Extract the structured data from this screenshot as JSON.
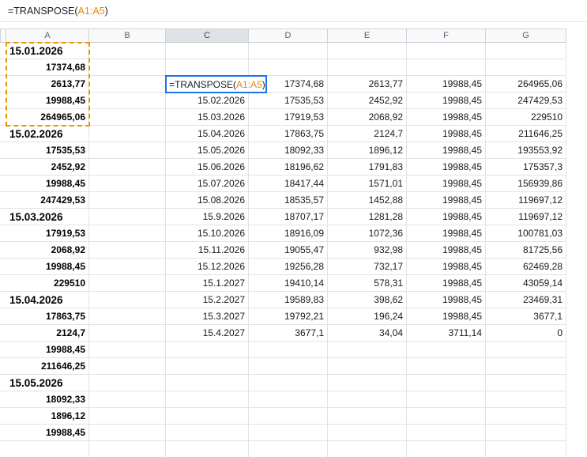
{
  "formula_bar": {
    "prefix": "=TRANSPOSE(",
    "range": "A1:A5",
    "suffix": ")"
  },
  "active_cell": {
    "address": "C3",
    "prefix": "=TRANSPOSE(",
    "range": "A1:A5",
    "suffix": ")"
  },
  "column_headers": [
    "A",
    "B",
    "C",
    "D",
    "E",
    "F",
    "G"
  ],
  "active_column": "C",
  "highlighted_range": "A1:A5",
  "colors": {
    "accent_blue": "#1a73e8",
    "range_orange": "#f09300",
    "formula_orange": "#ea8600",
    "header_bg": "#f8f9fa",
    "gridline": "#e2e3e3"
  },
  "cells": {
    "A": [
      {
        "r": 1,
        "t": "15.01.2026",
        "s": "da"
      },
      {
        "r": 2,
        "t": "17374,68",
        "s": "na"
      },
      {
        "r": 3,
        "t": "2613,77",
        "s": "na"
      },
      {
        "r": 4,
        "t": "19988,45",
        "s": "na"
      },
      {
        "r": 5,
        "t": "264965,06",
        "s": "na"
      },
      {
        "r": 6,
        "t": "15.02.2026",
        "s": "da"
      },
      {
        "r": 7,
        "t": "17535,53",
        "s": "na"
      },
      {
        "r": 8,
        "t": "2452,92",
        "s": "na"
      },
      {
        "r": 9,
        "t": "19988,45",
        "s": "na"
      },
      {
        "r": 10,
        "t": "247429,53",
        "s": "na"
      },
      {
        "r": 11,
        "t": "15.03.2026",
        "s": "da"
      },
      {
        "r": 12,
        "t": "17919,53",
        "s": "na"
      },
      {
        "r": 13,
        "t": "2068,92",
        "s": "na"
      },
      {
        "r": 14,
        "t": "19988,45",
        "s": "na"
      },
      {
        "r": 15,
        "t": "229510",
        "s": "na"
      },
      {
        "r": 16,
        "t": "15.04.2026",
        "s": "da"
      },
      {
        "r": 17,
        "t": "17863,75",
        "s": "na"
      },
      {
        "r": 18,
        "t": "2124,7",
        "s": "na"
      },
      {
        "r": 19,
        "t": "19988,45",
        "s": "na"
      },
      {
        "r": 20,
        "t": "211646,25",
        "s": "na"
      },
      {
        "r": 21,
        "t": "15.05.2026",
        "s": "da"
      },
      {
        "r": 22,
        "t": "18092,33",
        "s": "na"
      },
      {
        "r": 23,
        "t": "1896,12",
        "s": "na"
      },
      {
        "r": 24,
        "t": "19988,45",
        "s": "na"
      }
    ],
    "B": [],
    "C": [
      {
        "r": 4,
        "t": "15.02.2026",
        "s": "d"
      },
      {
        "r": 5,
        "t": "15.03.2026",
        "s": "d"
      },
      {
        "r": 6,
        "t": "15.04.2026",
        "s": "d"
      },
      {
        "r": 7,
        "t": "15.05.2026",
        "s": "d"
      },
      {
        "r": 8,
        "t": "15.06.2026",
        "s": "d"
      },
      {
        "r": 9,
        "t": "15.07.2026",
        "s": "d"
      },
      {
        "r": 10,
        "t": "15.08.2026",
        "s": "d"
      },
      {
        "r": 11,
        "t": "15.9.2026",
        "s": "d"
      },
      {
        "r": 12,
        "t": "15.10.2026",
        "s": "d"
      },
      {
        "r": 13,
        "t": "15.11.2026",
        "s": "d"
      },
      {
        "r": 14,
        "t": "15.12.2026",
        "s": "d"
      },
      {
        "r": 15,
        "t": "15.1.2027",
        "s": "d"
      },
      {
        "r": 16,
        "t": "15.2.2027",
        "s": "d"
      },
      {
        "r": 17,
        "t": "15.3.2027",
        "s": "d"
      },
      {
        "r": 18,
        "t": "15.4.2027",
        "s": "d"
      }
    ],
    "D": [
      {
        "r": 3,
        "t": "17374,68",
        "s": "n"
      },
      {
        "r": 4,
        "t": "17535,53",
        "s": "n"
      },
      {
        "r": 5,
        "t": "17919,53",
        "s": "n"
      },
      {
        "r": 6,
        "t": "17863,75",
        "s": "n"
      },
      {
        "r": 7,
        "t": "18092,33",
        "s": "n"
      },
      {
        "r": 8,
        "t": "18196,62",
        "s": "n"
      },
      {
        "r": 9,
        "t": "18417,44",
        "s": "n"
      },
      {
        "r": 10,
        "t": "18535,57",
        "s": "n"
      },
      {
        "r": 11,
        "t": "18707,17",
        "s": "n"
      },
      {
        "r": 12,
        "t": "18916,09",
        "s": "n"
      },
      {
        "r": 13,
        "t": "19055,47",
        "s": "n"
      },
      {
        "r": 14,
        "t": "19256,28",
        "s": "n"
      },
      {
        "r": 15,
        "t": "19410,14",
        "s": "n"
      },
      {
        "r": 16,
        "t": "19589,83",
        "s": "n"
      },
      {
        "r": 17,
        "t": "19792,21",
        "s": "n"
      },
      {
        "r": 18,
        "t": "3677,1",
        "s": "n"
      }
    ],
    "E": [
      {
        "r": 3,
        "t": "2613,77",
        "s": "n"
      },
      {
        "r": 4,
        "t": "2452,92",
        "s": "n"
      },
      {
        "r": 5,
        "t": "2068,92",
        "s": "n"
      },
      {
        "r": 6,
        "t": "2124,7",
        "s": "n"
      },
      {
        "r": 7,
        "t": "1896,12",
        "s": "n"
      },
      {
        "r": 8,
        "t": "1791,83",
        "s": "n"
      },
      {
        "r": 9,
        "t": "1571,01",
        "s": "n"
      },
      {
        "r": 10,
        "t": "1452,88",
        "s": "n"
      },
      {
        "r": 11,
        "t": "1281,28",
        "s": "n"
      },
      {
        "r": 12,
        "t": "1072,36",
        "s": "n"
      },
      {
        "r": 13,
        "t": "932,98",
        "s": "n"
      },
      {
        "r": 14,
        "t": "732,17",
        "s": "n"
      },
      {
        "r": 15,
        "t": "578,31",
        "s": "n"
      },
      {
        "r": 16,
        "t": "398,62",
        "s": "n"
      },
      {
        "r": 17,
        "t": "196,24",
        "s": "n"
      },
      {
        "r": 18,
        "t": "34,04",
        "s": "n"
      }
    ],
    "F": [
      {
        "r": 3,
        "t": "19988,45",
        "s": "n"
      },
      {
        "r": 4,
        "t": "19988,45",
        "s": "n"
      },
      {
        "r": 5,
        "t": "19988,45",
        "s": "n"
      },
      {
        "r": 6,
        "t": "19988,45",
        "s": "n"
      },
      {
        "r": 7,
        "t": "19988,45",
        "s": "n"
      },
      {
        "r": 8,
        "t": "19988,45",
        "s": "n"
      },
      {
        "r": 9,
        "t": "19988,45",
        "s": "n"
      },
      {
        "r": 10,
        "t": "19988,45",
        "s": "n"
      },
      {
        "r": 11,
        "t": "19988,45",
        "s": "n"
      },
      {
        "r": 12,
        "t": "19988,45",
        "s": "n"
      },
      {
        "r": 13,
        "t": "19988,45",
        "s": "n"
      },
      {
        "r": 14,
        "t": "19988,45",
        "s": "n"
      },
      {
        "r": 15,
        "t": "19988,45",
        "s": "n"
      },
      {
        "r": 16,
        "t": "19988,45",
        "s": "n"
      },
      {
        "r": 17,
        "t": "19988,45",
        "s": "n"
      },
      {
        "r": 18,
        "t": "3711,14",
        "s": "n"
      }
    ],
    "G": [
      {
        "r": 3,
        "t": "264965,06",
        "s": "n"
      },
      {
        "r": 4,
        "t": "247429,53",
        "s": "n"
      },
      {
        "r": 5,
        "t": "229510",
        "s": "n"
      },
      {
        "r": 6,
        "t": "211646,25",
        "s": "n"
      },
      {
        "r": 7,
        "t": "193553,92",
        "s": "n"
      },
      {
        "r": 8,
        "t": "175357,3",
        "s": "n"
      },
      {
        "r": 9,
        "t": "156939,86",
        "s": "n"
      },
      {
        "r": 10,
        "t": "119697,12",
        "s": "n"
      },
      {
        "r": 11,
        "t": "119697,12",
        "s": "n"
      },
      {
        "r": 12,
        "t": "100781,03",
        "s": "n"
      },
      {
        "r": 13,
        "t": "81725,56",
        "s": "n"
      },
      {
        "r": 14,
        "t": "62469,28",
        "s": "n"
      },
      {
        "r": 15,
        "t": "43059,14",
        "s": "n"
      },
      {
        "r": 16,
        "t": "23469,31",
        "s": "n"
      },
      {
        "r": 17,
        "t": "3677,1",
        "s": "n"
      },
      {
        "r": 18,
        "t": "0",
        "s": "n"
      }
    ]
  }
}
